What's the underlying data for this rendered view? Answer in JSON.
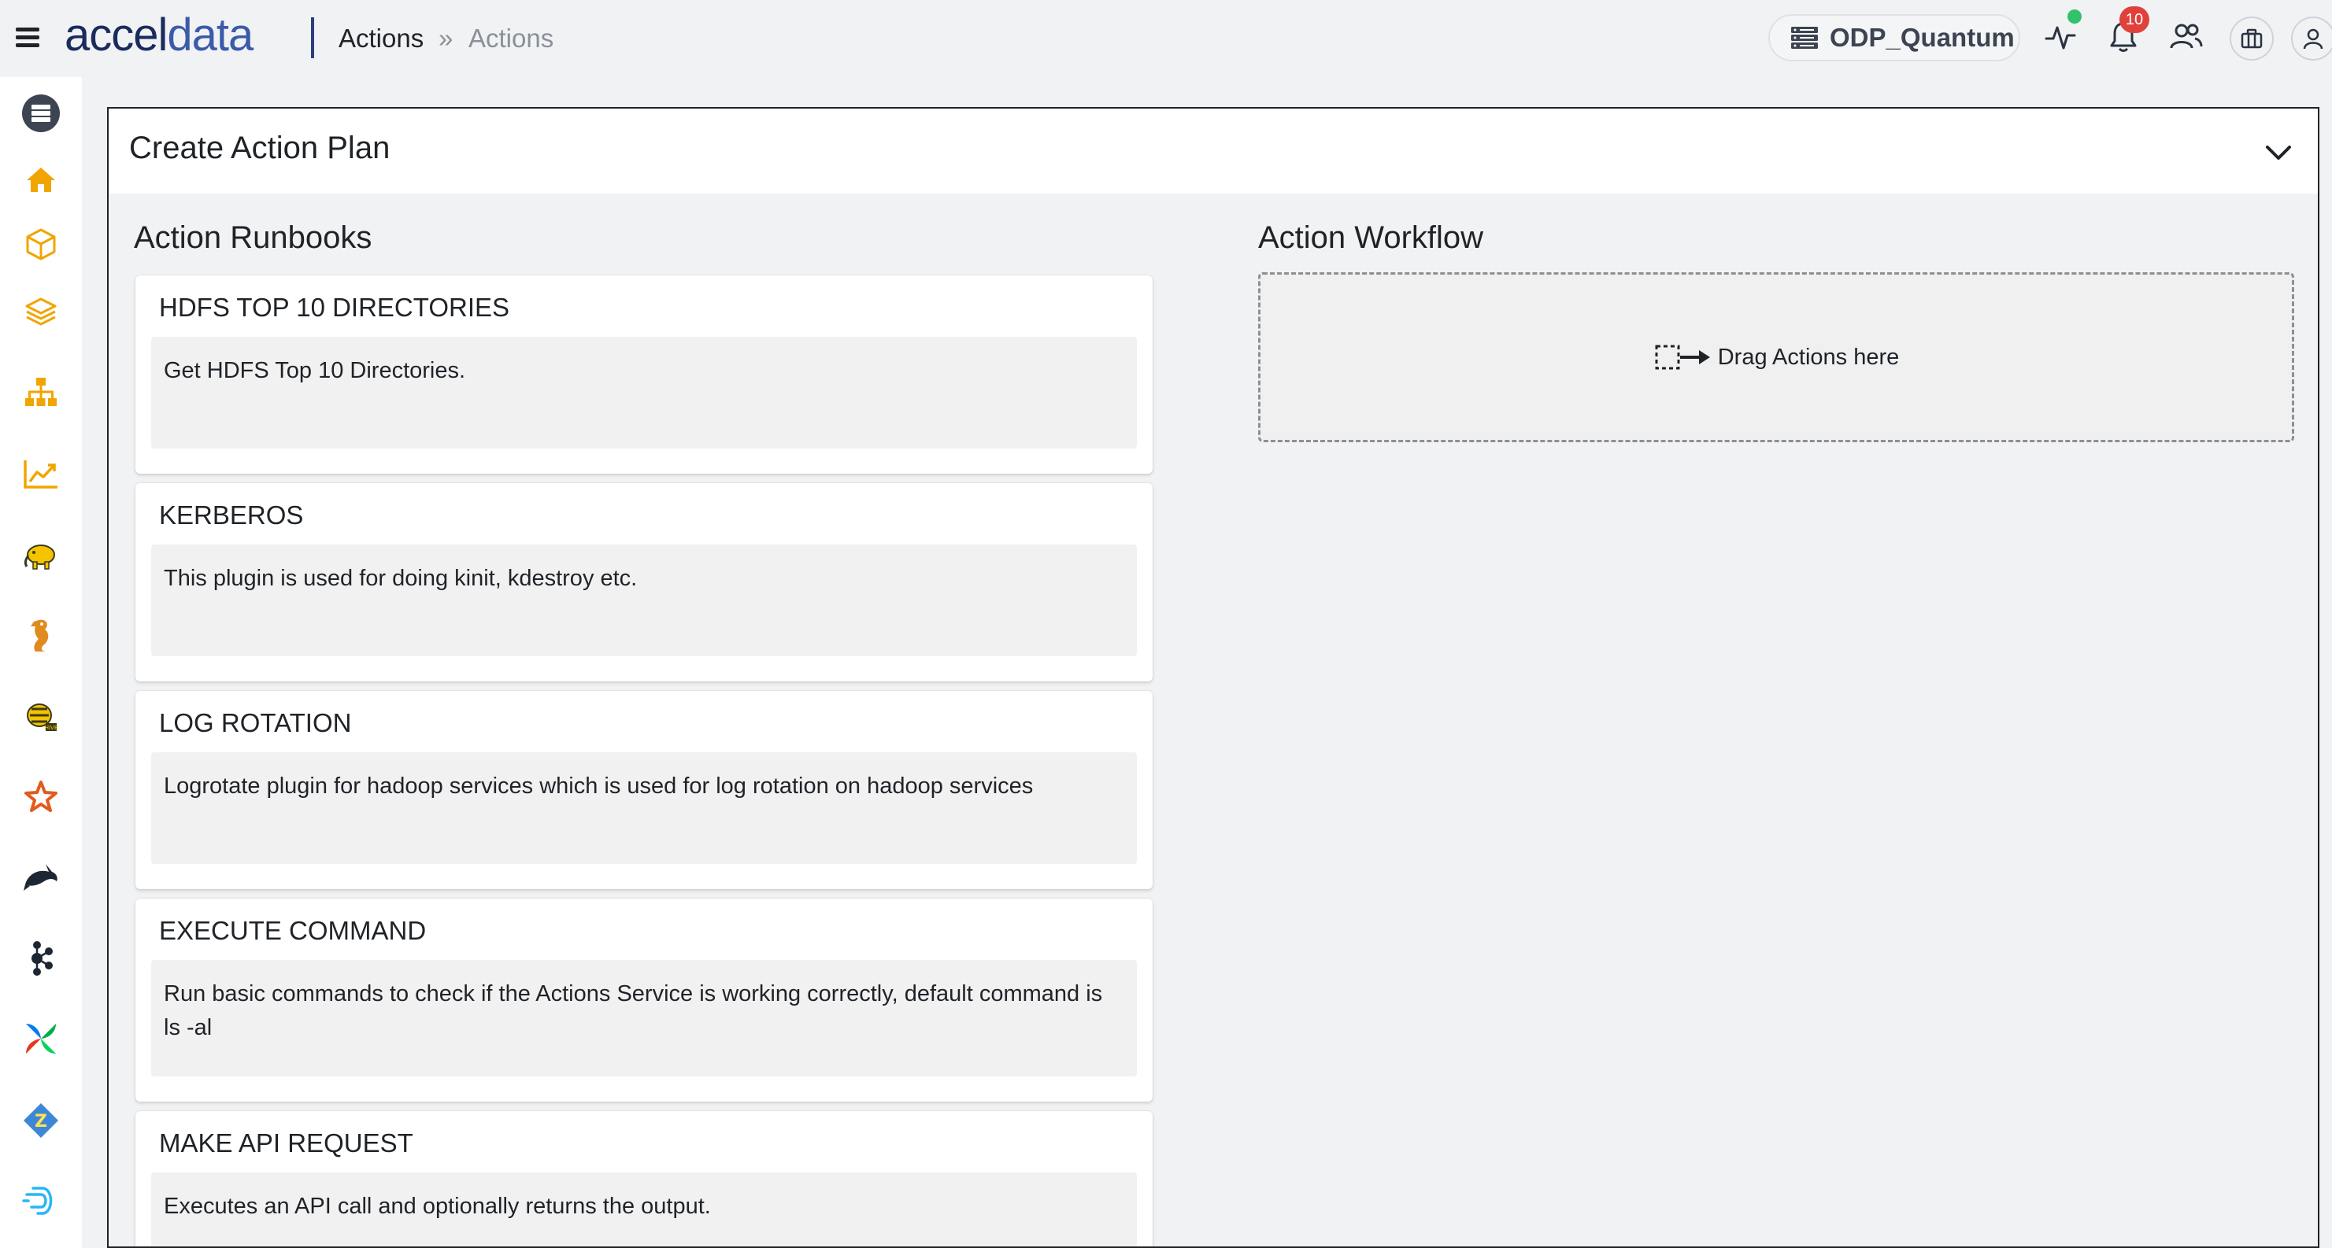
{
  "header": {
    "logo_part1": "accel",
    "logo_part2": "data",
    "breadcrumb": {
      "current": "Actions",
      "separator": "»",
      "tail": "Actions"
    },
    "cluster_name": "ODP_Quantum",
    "notification_count": "10",
    "icons": [
      "menu-icon",
      "server-icon",
      "activity-icon",
      "bell-icon",
      "users-icon",
      "briefcase-icon",
      "user-icon"
    ]
  },
  "sidebar": {
    "items": [
      {
        "icon": "server-stack-icon",
        "color": "#3d4452"
      },
      {
        "icon": "home-icon",
        "color": "#f0a500"
      },
      {
        "icon": "cube-icon",
        "color": "#f0a500"
      },
      {
        "icon": "layers-icon",
        "color": "#f0a500"
      },
      {
        "icon": "sitemap-icon",
        "color": "#f0a500"
      },
      {
        "icon": "trend-chart-icon",
        "color": "#f0a500"
      },
      {
        "icon": "hadoop-elephant-icon",
        "color": "#f5c400"
      },
      {
        "icon": "seahorse-icon",
        "color": "#e08a1f"
      },
      {
        "icon": "hive-bee-icon",
        "color": "#f5c400"
      },
      {
        "icon": "spark-star-icon",
        "color": "#e25a1c"
      },
      {
        "icon": "orca-icon",
        "color": "#1d2733"
      },
      {
        "icon": "kafka-icon",
        "color": "#1d2733"
      },
      {
        "icon": "airflow-pinwheel-icon",
        "color": "#017cee"
      },
      {
        "icon": "zeppelin-icon",
        "color": "#3e87d6"
      },
      {
        "icon": "druid-icon",
        "color": "#29b6f6"
      }
    ]
  },
  "main": {
    "card_title": "Create Action Plan",
    "runbooks_title": "Action Runbooks",
    "workflow_title": "Action Workflow",
    "dropzone_label": "Drag Actions here",
    "runbooks": [
      {
        "title": "HDFS TOP 10 DIRECTORIES",
        "description": "Get HDFS Top 10 Directories."
      },
      {
        "title": "KERBEROS",
        "description": "This plugin is used for doing kinit, kdestroy etc."
      },
      {
        "title": "LOG ROTATION",
        "description": "Logrotate plugin for hadoop services which is used for log rotation on hadoop services"
      },
      {
        "title": "EXECUTE COMMAND",
        "description": "Run basic commands to check if the Actions Service is working correctly, default command is ls -al"
      },
      {
        "title": "MAKE API REQUEST",
        "description": "Executes an API call and optionally returns the output."
      }
    ]
  }
}
